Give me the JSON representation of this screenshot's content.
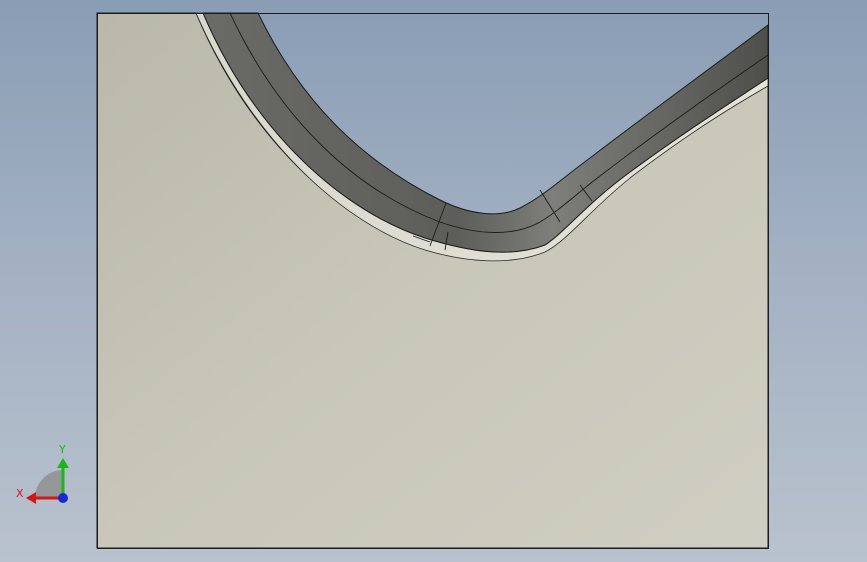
{
  "viewport": {
    "background_top": "#8a9db5",
    "background_bottom": "#b9c2ce",
    "part_face_color": "#c9c8ba",
    "part_edge_color": "#1c1c1c",
    "groove_band_color": "#5e5e5a",
    "groove_band_highlight": "#7c7c78"
  },
  "triad": {
    "x_label": "X",
    "y_label": "Y",
    "x_color": "#d01818",
    "y_color": "#18b818",
    "z_color": "#1a2ad0"
  }
}
